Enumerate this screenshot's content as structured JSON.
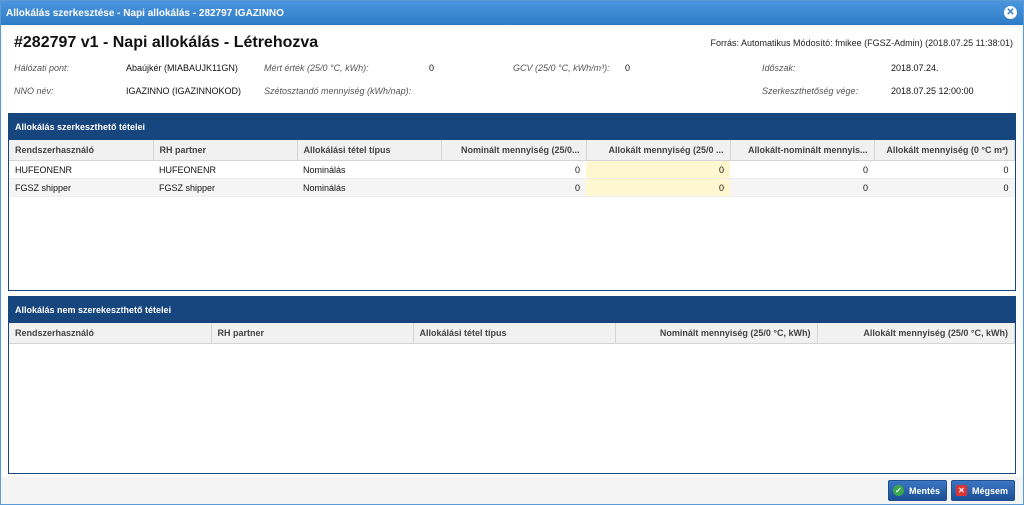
{
  "window": {
    "title": "Allokálás szerkesztése - Napi allokálás - 282797 IGAZINNO"
  },
  "header": {
    "title": "#282797 v1 - Napi allokálás - Létrehozva",
    "source": "Forrás: Automatikus Módosító: fmikee (FGSZ-Admin) (2018.07.25 11:38:01)"
  },
  "fields": {
    "halozati_pont_label": "Hálózati pont:",
    "halozati_pont_value": "Abaújkér (MIABAUJK11GN)",
    "mert_ertek_label": "Mért érték (25/0 °C, kWh):",
    "mert_ertek_value": "0",
    "gcv_label": "GCV (25/0 °C, kWh/m³):",
    "gcv_value": "0",
    "idoszak_label": "Időszak:",
    "idoszak_value": "2018.07.24.",
    "nno_label": "NNO név:",
    "nno_value": "IGAZINNO (IGAZINNOKOD)",
    "szetosztando_label": "Szétosztandó mennyiség (kWh/nap):",
    "szerkeszthetoseg_label": "Szerkeszthetőség vége:",
    "szerkeszthetoseg_value": "2018.07.25 12:00:00"
  },
  "editable_panel": {
    "title": "Allokálás szerkeszthető tételei",
    "columns": [
      "Rendszerhasználó",
      "RH partner",
      "Allokálási tétel típus",
      "Nominált mennyiség (25/0...",
      "Allokált mennyiség (25/0 ...",
      "Allokált-nominált mennyis...",
      "Allokált mennyiség (0 °C m³)"
    ],
    "rows": [
      [
        "HUFEONENR",
        "HUFEONENR",
        "Nominálás",
        "0",
        "0",
        "0",
        "0"
      ],
      [
        "FGSZ shipper",
        "FGSZ shipper",
        "Nominálás",
        "0",
        "0",
        "0",
        "0"
      ]
    ]
  },
  "readonly_panel": {
    "title": "Allokálás nem szerekeszthető tételei",
    "columns": [
      "Rendszerhasználó",
      "RH partner",
      "Allokálási tétel típus",
      "Nominált mennyiség (25/0 °C, kWh)",
      "Allokált mennyiség (25/0 °C, kWh)"
    ]
  },
  "buttons": {
    "save": "Mentés",
    "cancel": "Mégsem"
  },
  "colors": {
    "titlebar": "#2f7cc8",
    "panel_header": "#17457d",
    "highlight_cell": "#fff7cf"
  }
}
